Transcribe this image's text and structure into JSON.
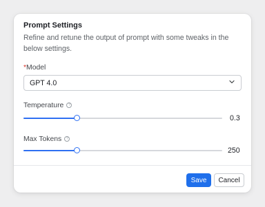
{
  "dialog": {
    "title": "Prompt Settings",
    "description": "Refine and retune the output of prompt with some tweaks in the below settings."
  },
  "model": {
    "required_mark": "*",
    "label": "Model",
    "selected": "GPT 4.0"
  },
  "temperature": {
    "label": "Temperature",
    "value": "0.3",
    "fraction": 0.27
  },
  "max_tokens": {
    "label": "Max Tokens",
    "value": "250",
    "fraction": 0.27
  },
  "actions": {
    "save_label": "Save",
    "cancel_label": "Cancel"
  },
  "colors": {
    "accent": "#1f6feb",
    "background": "#eeeeef"
  },
  "icons": {
    "info": "info-icon",
    "dropdown": "chevron-down-icon"
  }
}
